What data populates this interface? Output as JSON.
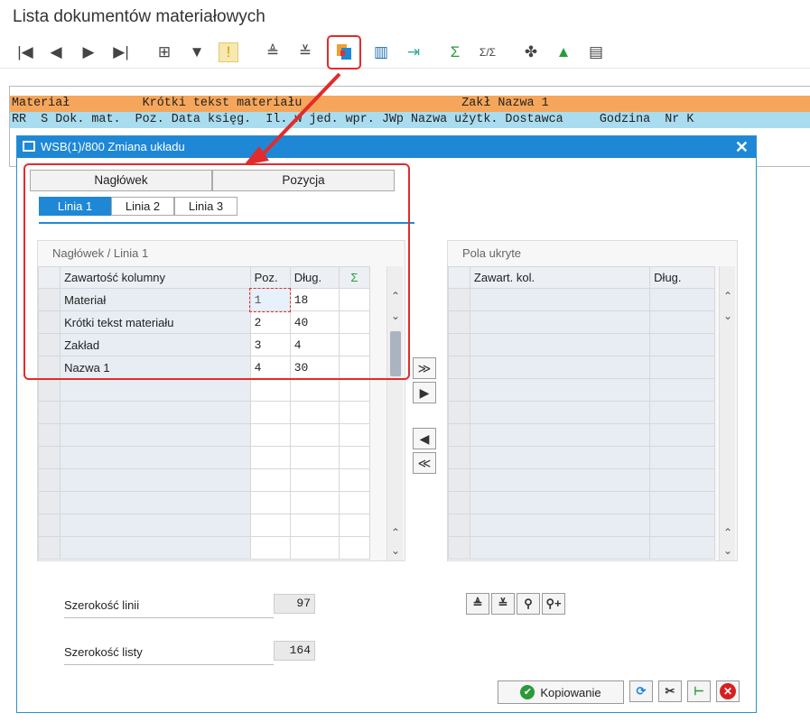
{
  "app": {
    "title": "Lista dokumentów materiałowych"
  },
  "toolbar": {
    "icons": [
      "first-page-icon",
      "prev-page-icon",
      "next-page-icon",
      "last-page-icon",
      "details-icon",
      "filter-icon",
      "note-icon",
      "sort-ascending-icon",
      "sort-descending-icon",
      "change-layout-icon",
      "columns-icon",
      "export-icon",
      "sum-icon",
      "subtotal-icon",
      "puzzle-icon",
      "chart-icon",
      "abacus-icon"
    ],
    "glyphs": [
      "|◀",
      "◀",
      "▶",
      "▶|",
      "⊞",
      "▼",
      "!",
      "≜",
      "≚",
      "▦",
      "▥",
      "⇥",
      "Σ",
      "Σ/Σ",
      "✤",
      "▲",
      "▤"
    ]
  },
  "list": {
    "header_row1": "Materiał          Krótki tekst materiału                      Zakł Nazwa 1",
    "header_row2": "RR  S Dok. mat.  Poz. Data księg.  Il. w jed. wpr. JWp Nazwa użytk. Dostawca     Godzina  Nr K"
  },
  "dialog": {
    "title": "WSB(1)/800 Zmiana układu",
    "tabs": [
      "Nagłówek",
      "Pozycja"
    ],
    "subtabs": [
      "Linia 1",
      "Linia 2",
      "Linia 3"
    ],
    "left_panel": {
      "title": "Nagłówek / Linia 1",
      "columns": [
        "Zawartość kolumny",
        "Poz.",
        "Dług.",
        "Σ"
      ],
      "rows": [
        {
          "name": "Materiał",
          "pos": "1",
          "len": "18"
        },
        {
          "name": "Krótki tekst materiału",
          "pos": "2",
          "len": "40"
        },
        {
          "name": "Zakład",
          "pos": "3",
          "len": "4"
        },
        {
          "name": "Nazwa 1",
          "pos": "4",
          "len": "30"
        }
      ]
    },
    "right_panel": {
      "title": "Pola ukryte",
      "columns": [
        "Zawart. kol.",
        "Dług."
      ]
    },
    "line_width_label": "Szerokość linii",
    "line_width_value": "97",
    "list_width_label": "Szerokość listy",
    "list_width_value": "164",
    "copy_button": "Kopiowanie"
  },
  "colors": {
    "accent": "#1e88d6",
    "highlight": "#e32b2b",
    "header_orange": "#f6a65a",
    "header_blue": "#a9dcef"
  }
}
